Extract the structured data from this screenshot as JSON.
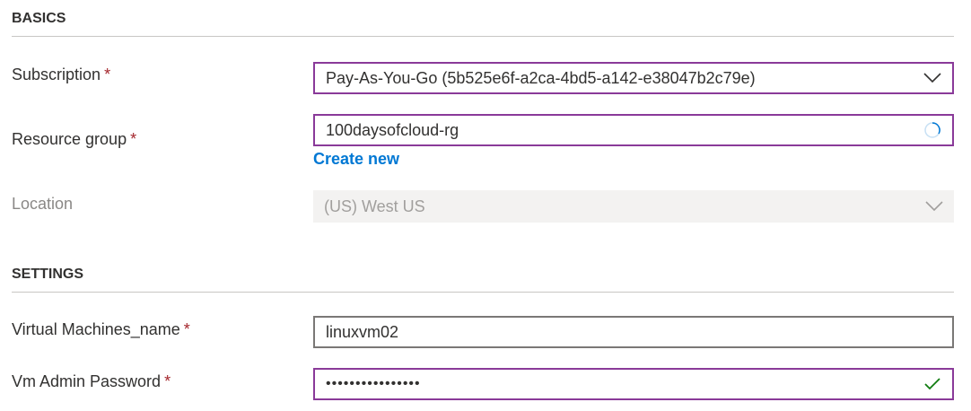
{
  "sections": {
    "basics": "BASICS",
    "settings": "SETTINGS"
  },
  "required_marker": "*",
  "fields": {
    "subscription": {
      "label": "Subscription",
      "value": "Pay-As-You-Go (5b525e6f-a2ca-4bd5-a142-e38047b2c79e)"
    },
    "resource_group": {
      "label": "Resource group",
      "value": "100daysofcloud-rg",
      "create_new": "Create new"
    },
    "location": {
      "label": "Location",
      "value": "(US) West US"
    },
    "vm_name": {
      "label": "Virtual Machines_name",
      "value": "linuxvm02"
    },
    "vm_password": {
      "label": "Vm Admin Password",
      "value": "••••••••••••••••"
    }
  },
  "icons": {
    "dropdown": "chevron-down-icon",
    "loading": "spinner-icon",
    "valid": "checkmark-icon"
  },
  "colors": {
    "focus_border": "#8a3a99",
    "link": "#0078d4",
    "required": "#a4262c",
    "valid": "#107c10"
  }
}
